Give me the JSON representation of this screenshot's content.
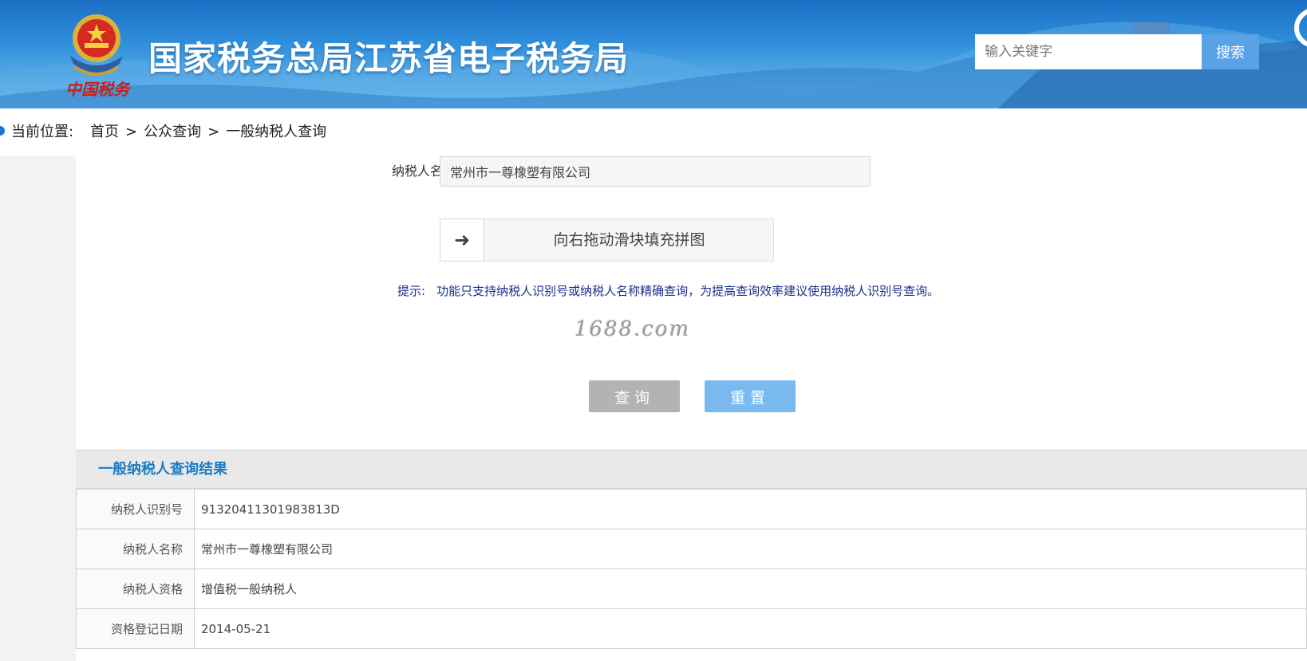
{
  "header": {
    "emblem_caption": "中国税务",
    "site_title": "国家税务总局江苏省电子税务局",
    "search_placeholder": "输入关键字",
    "search_button": "搜索"
  },
  "breadcrumb": {
    "label": "当前位置:",
    "items": [
      "首页",
      "公众查询",
      "一般纳税人查询"
    ],
    "separator": ">"
  },
  "form": {
    "name_label": "纳税人名称",
    "name_value": "常州市一尊橡塑有限公司",
    "slider_text": "向右拖动滑块填充拼图",
    "hint_label": "提示:",
    "hint_text": "功能只支持纳税人识别号或纳税人名称精确查询，为提高查询效率建议使用纳税人识别号查询。",
    "watermark": "1688.com",
    "query_button": "查询",
    "reset_button": "重置"
  },
  "result": {
    "title": "一般纳税人查询结果",
    "rows": [
      {
        "key": "纳税人识别号",
        "value": "91320411301983813D"
      },
      {
        "key": "纳税人名称",
        "value": "常州市一尊橡塑有限公司"
      },
      {
        "key": "纳税人资格",
        "value": "增值税一般纳税人"
      },
      {
        "key": "资格登记日期",
        "value": "2014-05-21"
      }
    ]
  },
  "colors": {
    "header_blue": "#2f8fdc",
    "accent_blue": "#1a7bc4",
    "hint_navy": "#1a2f8c",
    "query_gray": "#b3b3b3",
    "reset_blue": "#7bbaf0"
  },
  "icons": {
    "slider_handle": "arrow-right-icon",
    "emblem": "national-emblem-icon"
  }
}
